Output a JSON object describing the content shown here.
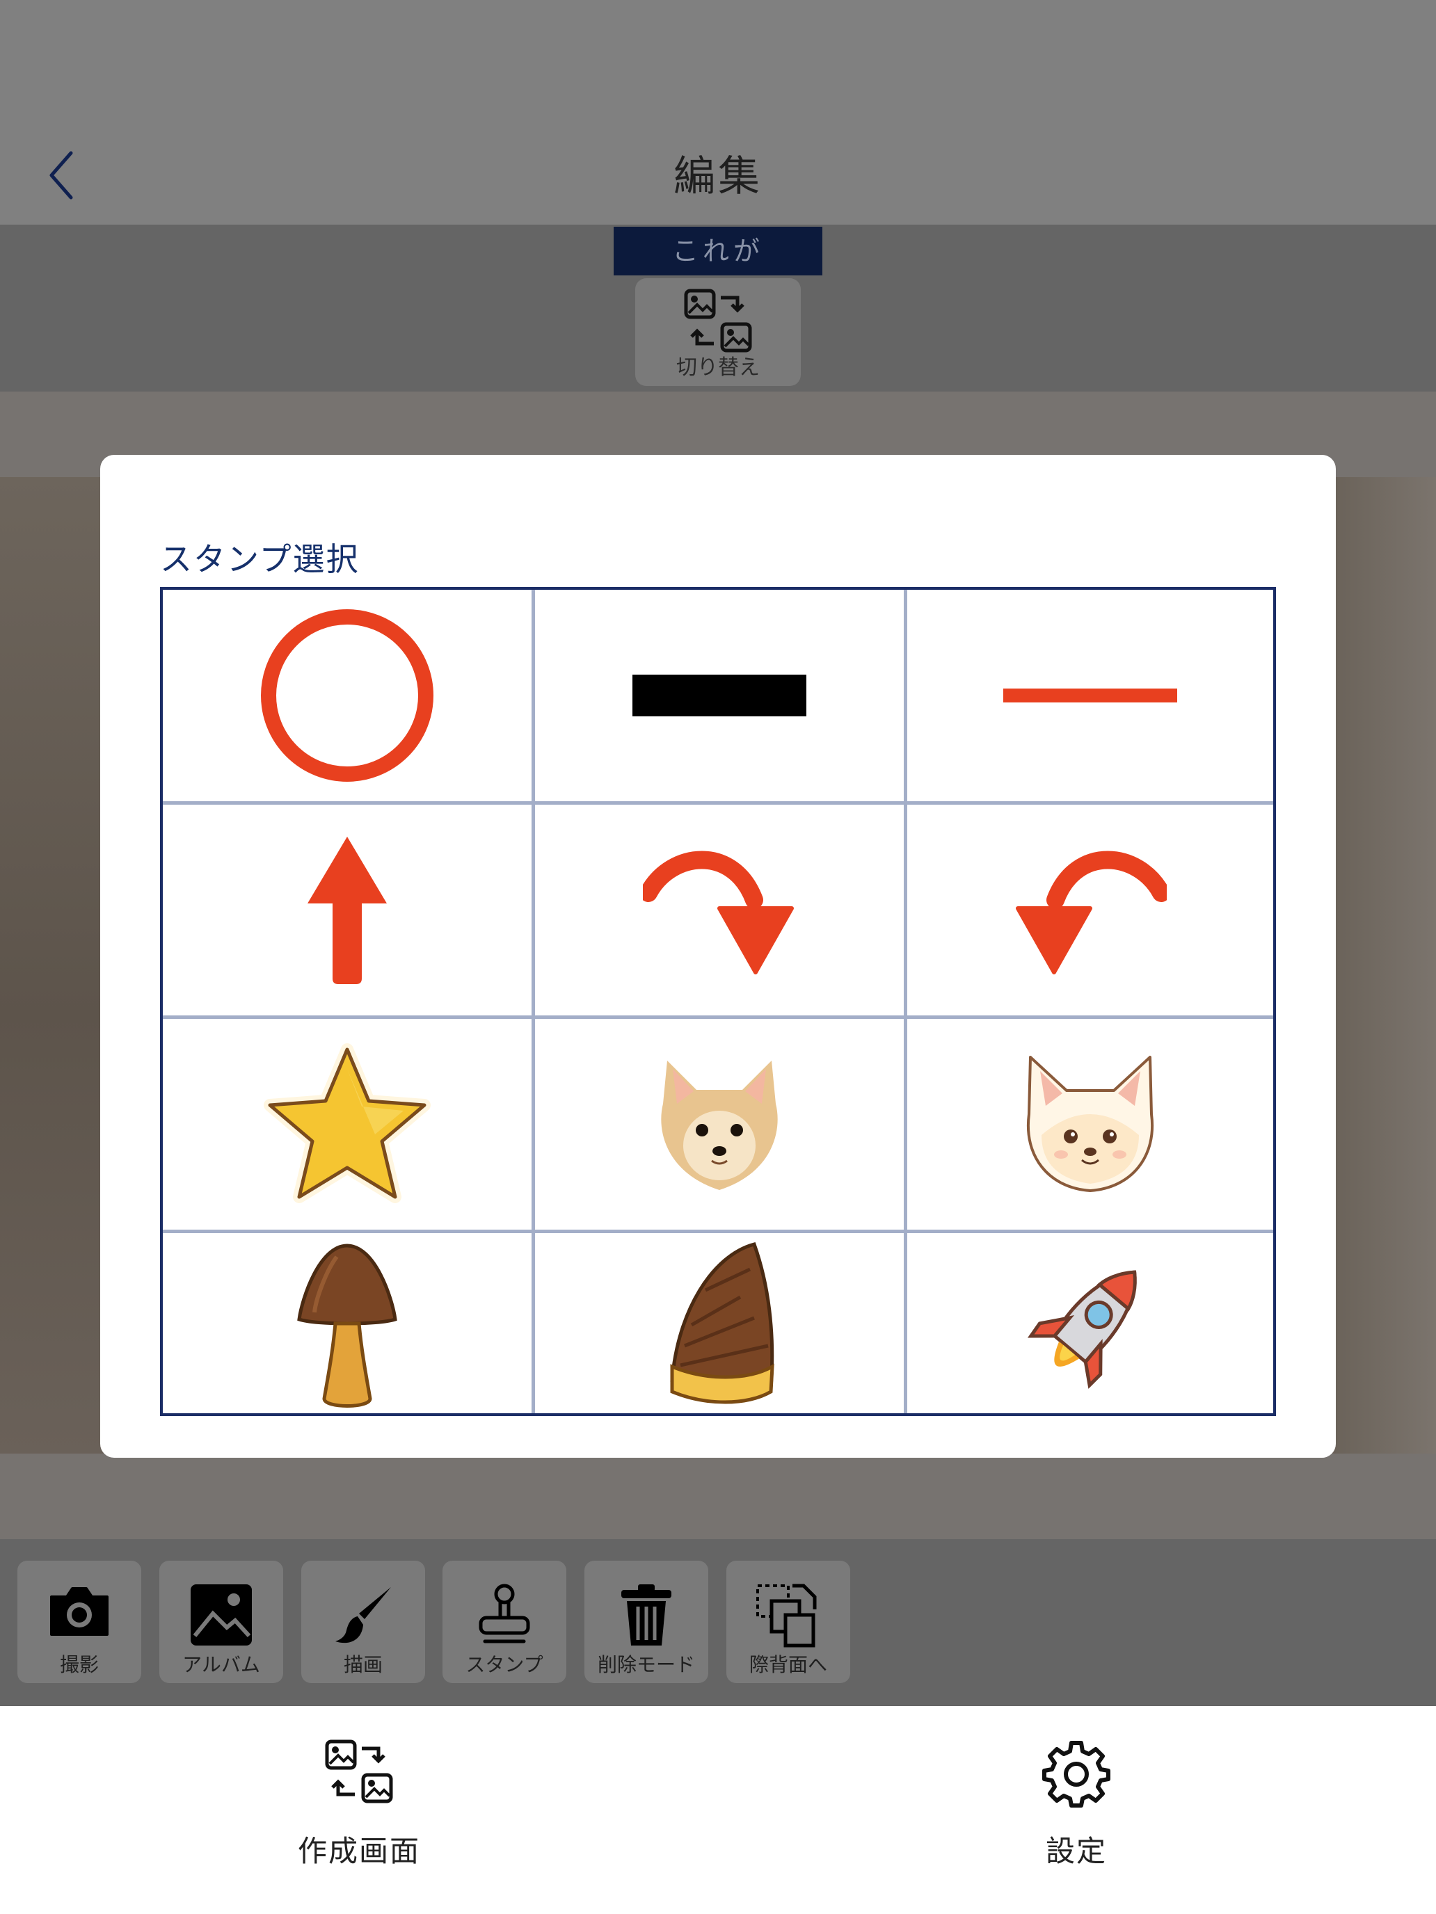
{
  "nav": {
    "title": "編集",
    "back_icon": "chevron-left-icon"
  },
  "source_label": "これが",
  "switch_button": {
    "label": "切り替え",
    "icon": "image-swap-icon"
  },
  "stamp_dialog": {
    "title": "スタンプ選択",
    "stamps": [
      {
        "name": "red-circle",
        "icon": "circle-outline-icon"
      },
      {
        "name": "black-bar",
        "icon": "black-rectangle-icon"
      },
      {
        "name": "red-line",
        "icon": "red-line-icon"
      },
      {
        "name": "red-up-arrow",
        "icon": "arrow-up-icon"
      },
      {
        "name": "red-curved-arrow-right",
        "icon": "curved-arrow-clockwise-icon"
      },
      {
        "name": "red-curved-arrow-left",
        "icon": "curved-arrow-counterclockwise-icon"
      },
      {
        "name": "star",
        "icon": "star-icon"
      },
      {
        "name": "chihuahua-photo",
        "icon": "dog-photo-icon"
      },
      {
        "name": "chihuahua-illustration",
        "icon": "dog-illustration-icon"
      },
      {
        "name": "mushroom",
        "icon": "mushroom-icon"
      },
      {
        "name": "bamboo-shoot",
        "icon": "bamboo-shoot-icon"
      },
      {
        "name": "rocket",
        "icon": "rocket-icon"
      }
    ]
  },
  "toolbar": {
    "items": [
      {
        "label": "撮影",
        "icon": "camera-icon"
      },
      {
        "label": "アルバム",
        "icon": "photo-album-icon"
      },
      {
        "label": "描画",
        "icon": "brush-icon"
      },
      {
        "label": "スタンプ",
        "icon": "stamp-icon"
      },
      {
        "label": "削除モード",
        "icon": "trash-icon"
      },
      {
        "label": "際背面へ",
        "icon": "send-to-back-icon"
      }
    ]
  },
  "tabbar": {
    "items": [
      {
        "label": "作成画面",
        "icon": "image-swap-icon"
      },
      {
        "label": "設定",
        "icon": "gear-icon"
      }
    ]
  },
  "colors": {
    "accent": "#15306b",
    "stamp_red": "#e8401f",
    "grid_line": "#a3aec8"
  }
}
